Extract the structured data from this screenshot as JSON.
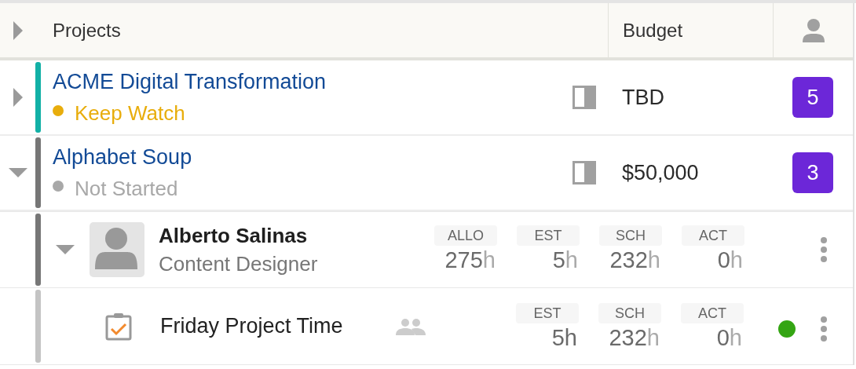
{
  "header": {
    "expanded": false,
    "columns": [
      "Projects",
      "Budget"
    ]
  },
  "projects": [
    {
      "name": "ACME Digital Transformation",
      "status": {
        "label": "Keep Watch",
        "color": "#e8ad0c"
      },
      "color": "#12b0a6",
      "expanded": false,
      "budget": "TBD",
      "count": "5"
    },
    {
      "name": "Alphabet Soup",
      "status": {
        "label": "Not Started",
        "color": "#a8a8a8"
      },
      "color": "#767676",
      "expanded": true,
      "budget": "$50,000",
      "count": "3",
      "children": [
        {
          "name": "Alberto Salinas",
          "role": "Content Designer",
          "expanded": true,
          "metrics": [
            {
              "label": "ALLO",
              "value": "275",
              "unit": "h",
              "emphasized": false
            },
            {
              "label": "EST",
              "value": "5",
              "unit": "h",
              "emphasized": false
            },
            {
              "label": "SCH",
              "value": "232",
              "unit": "h",
              "emphasized": false
            },
            {
              "label": "ACT",
              "value": "0",
              "unit": "h",
              "emphasized": false
            }
          ],
          "children": [
            {
              "name": "Friday Project Time",
              "color": "#34a513",
              "metrics": [
                {
                  "label": "EST",
                  "value": "5",
                  "unit": "h",
                  "emphasized": true
                },
                {
                  "label": "SCH",
                  "value": "232",
                  "unit": "h",
                  "emphasized": false
                },
                {
                  "label": "ACT",
                  "value": "0",
                  "unit": "h",
                  "emphasized": false
                }
              ]
            }
          ]
        }
      ]
    }
  ]
}
